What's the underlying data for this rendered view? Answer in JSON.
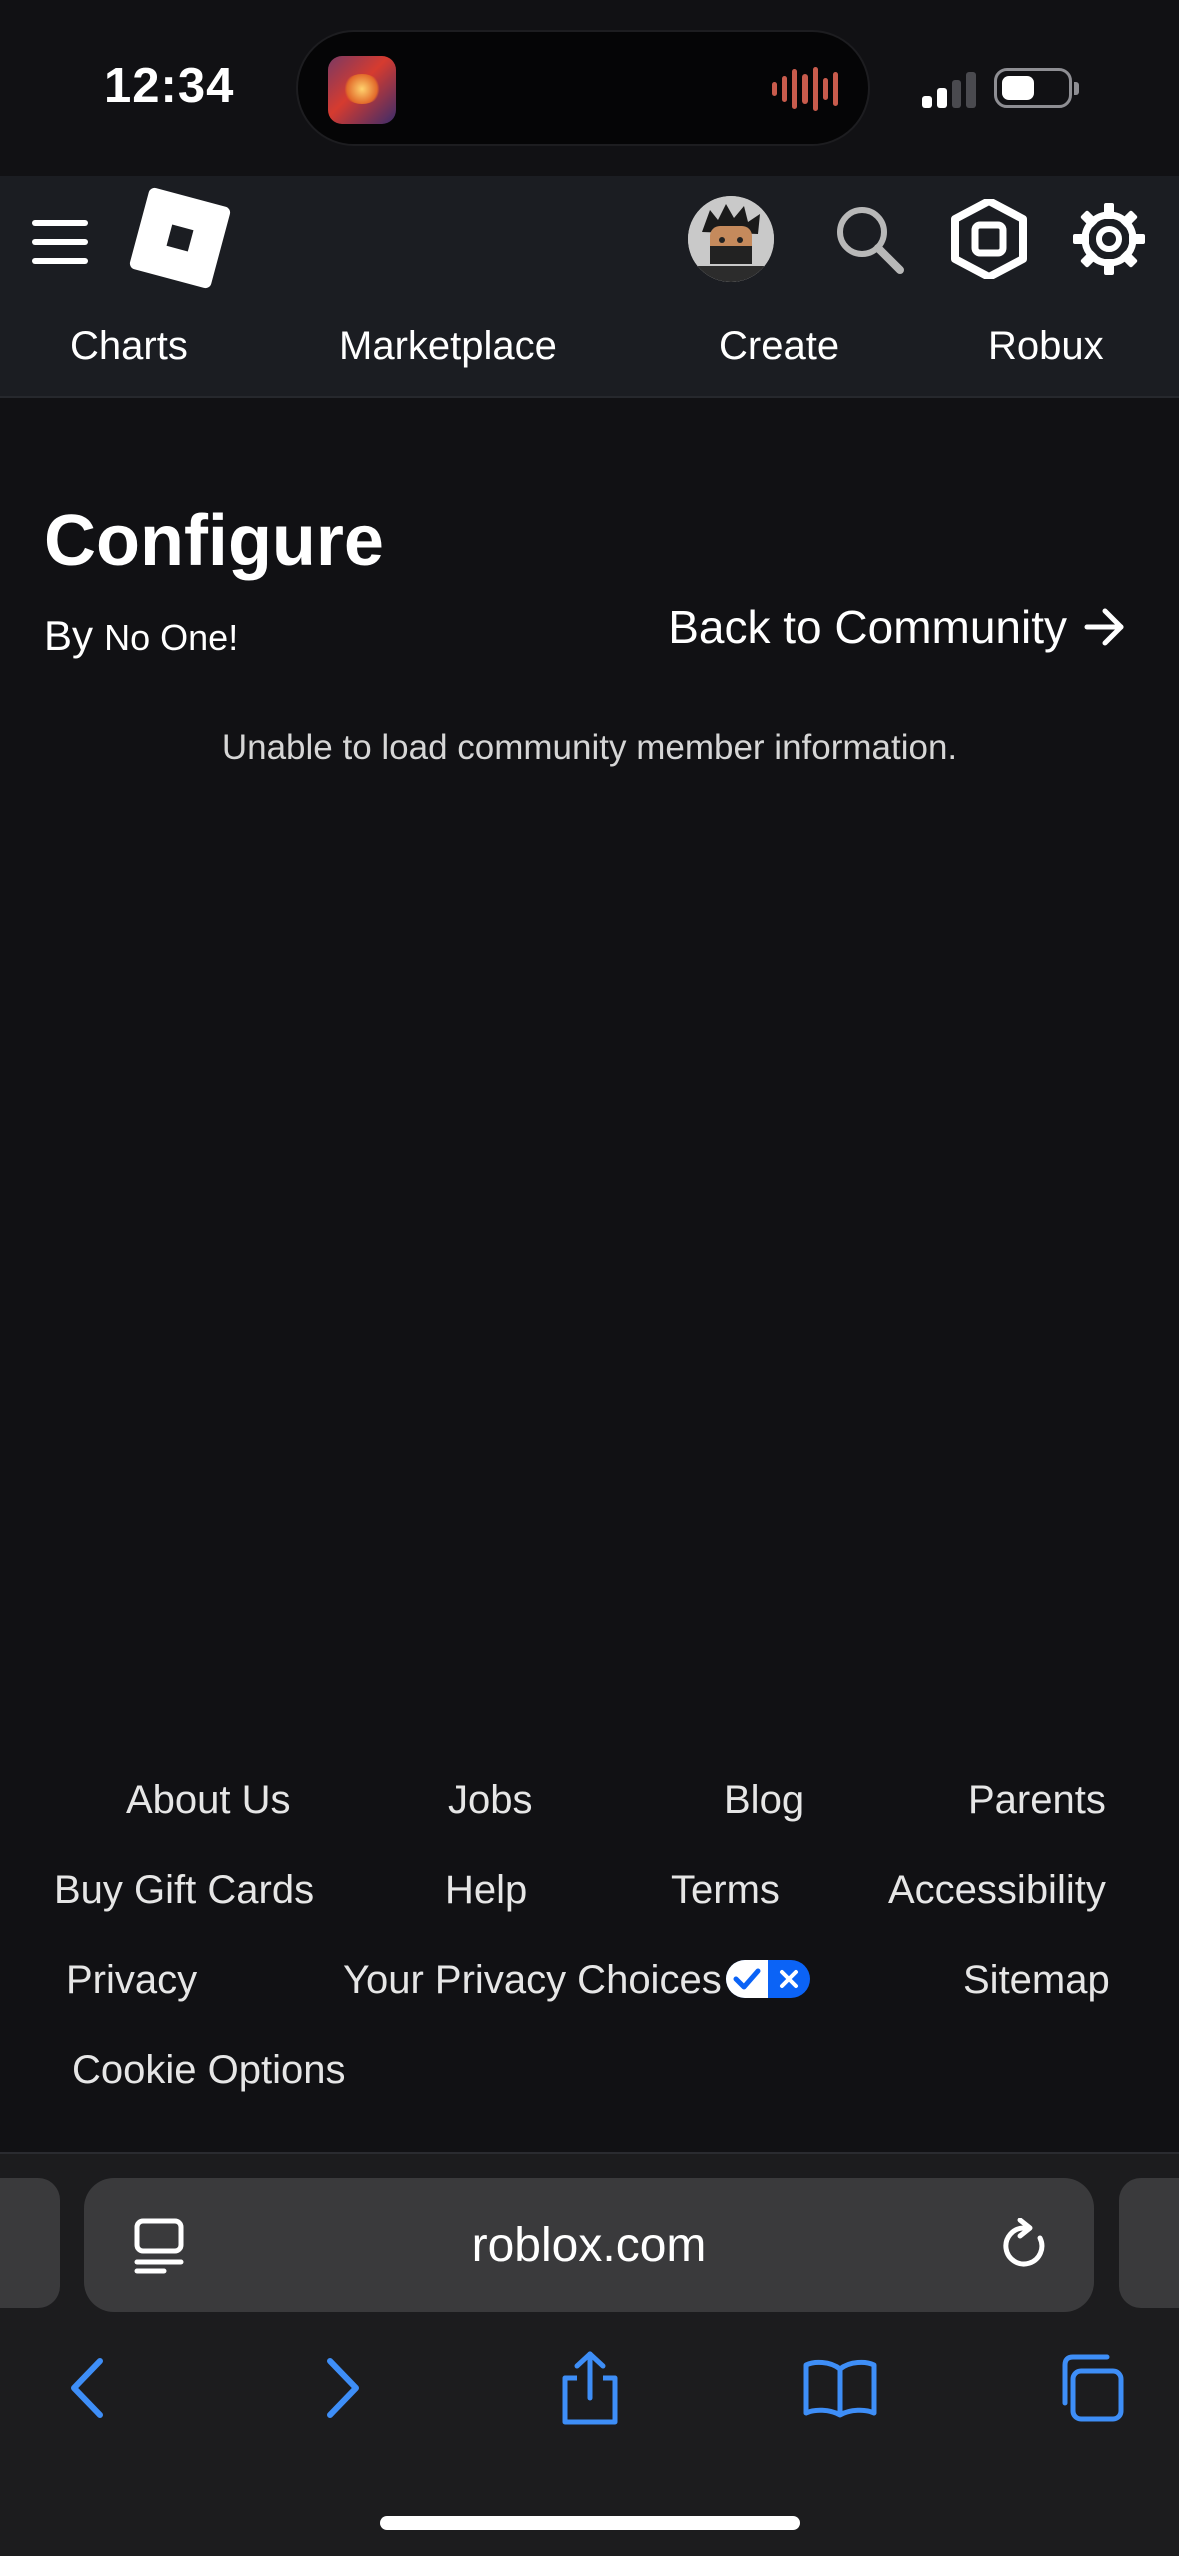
{
  "status_bar": {
    "time": "12:34"
  },
  "header": {
    "nav_tabs": [
      "Charts",
      "Marketplace",
      "Create",
      "Robux"
    ]
  },
  "main": {
    "title": "Configure",
    "owner_prefix": "By",
    "owner_name": "No One!",
    "back_link": "Back to Community",
    "error_message": "Unable to load community member information."
  },
  "footer": {
    "links": [
      "About Us",
      "Jobs",
      "Blog",
      "Parents",
      "Buy Gift Cards",
      "Help",
      "Terms",
      "Accessibility",
      "Privacy",
      "Your Privacy Choices",
      "Sitemap",
      "Cookie Options"
    ]
  },
  "browser": {
    "url": "roblox.com"
  },
  "colors": {
    "background": "#111114",
    "header_bg": "#1b1d22",
    "privacy_badge": "#0b63f6",
    "safari_accent": "#3e8ef7"
  }
}
